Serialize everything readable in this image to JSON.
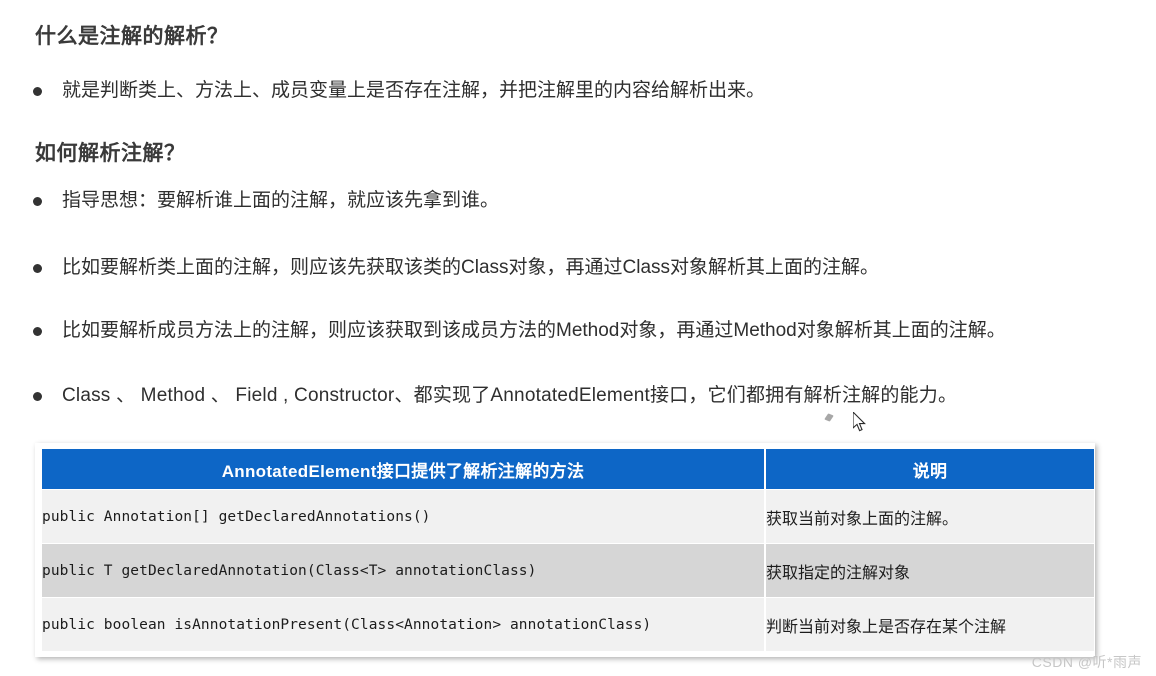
{
  "headings": {
    "h1": "什么是注解的解析？",
    "h2": "如何解析注解？"
  },
  "bullets": [
    {
      "text": "就是判断类上、方法上、成员变量上是否存在注解，并把注解里的内容给解析出来。"
    },
    {
      "text": "指导思想：要解析谁上面的注解，就应该先拿到谁。"
    },
    {
      "text": "比如要解析类上面的注解，则应该先获取该类的Class对象，再通过Class对象解析其上面的注解。"
    },
    {
      "text": "比如要解析成员方法上的注解，则应该获取到该成员方法的Method对象，再通过Method对象解析其上面的注解。"
    },
    {
      "text": "Class 、 Method 、 Field , Constructor、都实现了AnnotatedElement接口，它们都拥有解析注解的能力。"
    }
  ],
  "table": {
    "headers": {
      "signature": "AnnotatedElement接口提供了解析注解的方法",
      "description": "说明"
    },
    "rows": [
      {
        "signature": "public Annotation[] getDeclaredAnnotations()",
        "description": "获取当前对象上面的注解。"
      },
      {
        "signature": "public T getDeclaredAnnotation(Class<T> annotationClass)",
        "description": "获取指定的注解对象"
      },
      {
        "signature": "public boolean isAnnotationPresent(Class<Annotation> annotationClass)",
        "description": "判断当前对象上是否存在某个注解"
      }
    ],
    "colors": {
      "header_bg": "#0d66c6",
      "header_text": "#ffffff",
      "row_light_bg": "#f1f1f1",
      "row_dark_bg": "#d6d6d6"
    }
  },
  "watermark": "CSDN @听*雨声"
}
